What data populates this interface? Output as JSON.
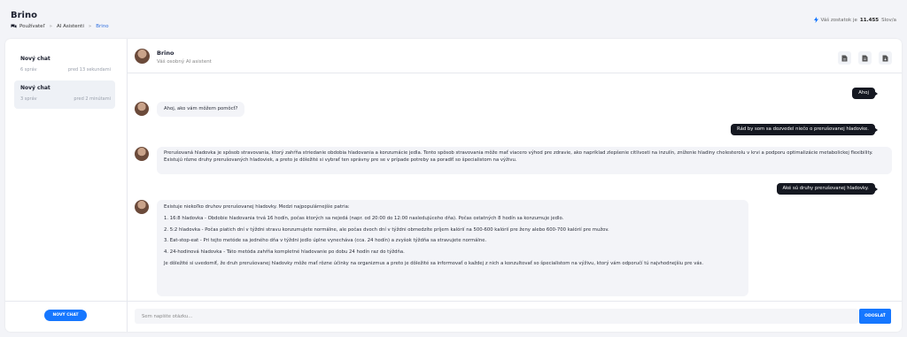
{
  "header": {
    "title": "Brino",
    "breadcrumb": [
      "Používateľ",
      "AI Asistenti",
      "Brino"
    ],
    "credit_prefix": "Váš zostatok je",
    "credit_value": "11.455",
    "credit_suffix": "Slov/a"
  },
  "sidebar": {
    "chats": [
      {
        "title": "Nový chat",
        "count": "6 správ",
        "time": "pred 13 sekundami"
      },
      {
        "title": "Nový chat",
        "count": "3 správ",
        "time": "pred 2 minútami"
      }
    ],
    "new_chat_label": "NOVÝ CHAT"
  },
  "chat": {
    "bot_name": "Brino",
    "bot_subtitle": "Váš osobný AI asistent",
    "header_icons": [
      "file-icon",
      "document-icon",
      "export-icon"
    ],
    "messages": [
      {
        "role": "user",
        "text": "Ahoj"
      },
      {
        "role": "bot",
        "text": "Ahoj, ako vám môžem pomôcť?"
      },
      {
        "role": "user",
        "text": "Rád by som sa dozvedel niečo o prerušovanej hladovke."
      },
      {
        "role": "bot",
        "text": "Prerušovaná hladovka je spôsob stravovania, ktorý zahŕňa striedanie obdobia hladovania a konzumácie jedla. Tento spôsob stravovania môže mať viacero výhod pre zdravie, ako napríklad zlepšenie citlivosti na inzulín, zníženie hladiny cholesterolu v krvi a podporu optimalizácie metabolickej flexibility. Existujú rôzne druhy prerušovaných hladoviek, a preto je dôležité si vybrať ten správny pre se v prípade potreby sa poradiť so špecialistom na výživu."
      },
      {
        "role": "user",
        "text": "Aké sú druhy prerušovanej hladovky."
      },
      {
        "role": "bot",
        "paragraphs": [
          "Existuje niekoľko druhov prerušovanej hladovky. Medzi najpopulárnejšie patria:",
          "1. 16:8 hladovka - Obdobie hladovania trvá 16 hodín, počas ktorých sa nejedá (napr. od 20:00 do 12:00 nasledujúceho dňa). Počas ostatných 8 hodín sa konzumuje jedlo.",
          "2. 5:2 hladovka - Počas piatich dní v týždni stravu konzumujete normálne, ale počas dvoch dní v týždni obmedzíte príjem kalórií na 500-600 kalórií pre ženy alebo 600-700 kalórií pre mužov.",
          "3. Eat-stop-eat - Pri tejto metóde sa jedného dňa v týždni jedlo úplne vynecháva (cca. 24 hodín) a zvyšok týždňa sa stravujete normálne.",
          "4. 24-hodinová hladovka - Táto metóda zahŕňa kompletné hladovanie po dobu 24 hodín raz do týždňa.",
          "Je dôležité si uvedomiť, že druh prerušovanej hladovky môže mať rôzne účinky na organizmus a preto je dôležité sa informovať o každej z nich a konzultovať so špecialistom na výživu, ktorý vám odporučí tú najvhodnejšiu pre vás."
        ]
      }
    ],
    "input_placeholder": "Sem napíšte otázku...",
    "send_label": "ODOSLAŤ"
  },
  "colors": {
    "accent": "#1677ff",
    "user_bubble": "#151821",
    "bot_bubble": "#f3f4f8",
    "background": "#f3f4f8"
  }
}
